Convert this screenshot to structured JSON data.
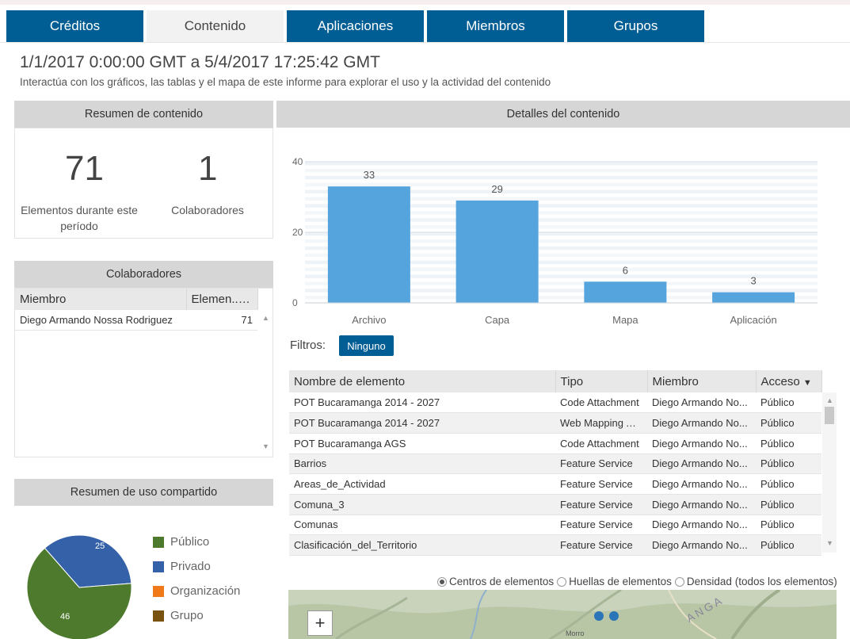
{
  "tabs": [
    {
      "label": "Créditos",
      "active": false
    },
    {
      "label": "Contenido",
      "active": true
    },
    {
      "label": "Aplicaciones",
      "active": false
    },
    {
      "label": "Miembros",
      "active": false
    },
    {
      "label": "Grupos",
      "active": false
    }
  ],
  "header": {
    "date_range": "1/1/2017 0:00:00 GMT a 5/4/2017 17:25:42 GMT",
    "subtitle": "Interactúa con los gráficos, las tablas y el mapa de este informe para explorar el uso y la actividad del contenido"
  },
  "summary": {
    "title": "Resumen de contenido",
    "items_count": "71",
    "items_label_1": "Elementos durante este",
    "items_label_2": "período",
    "contributors_count": "1",
    "contributors_label": "Colaboradores"
  },
  "contributors": {
    "title": "Colaboradores",
    "col_member": "Miembro",
    "col_items": "Elemen...",
    "rows": [
      {
        "member": "Diego Armando Nossa Rodriguez",
        "items": "71"
      }
    ]
  },
  "sharing": {
    "title": "Resumen de uso compartido",
    "legend": [
      {
        "label": "Público",
        "color": "#4e7a2e"
      },
      {
        "label": "Privado",
        "color": "#3461a8"
      },
      {
        "label": "Organización",
        "color": "#f07a1a"
      },
      {
        "label": "Grupo",
        "color": "#7a5210"
      }
    ],
    "pie_labels": {
      "privado": "25",
      "publico": "46"
    }
  },
  "details": {
    "title": "Detalles del contenido",
    "filters_label": "Filtros:",
    "filter_button": "Ninguno"
  },
  "chart_data": {
    "type": "bar",
    "categories": [
      "Archivo",
      "Capa",
      "Mapa",
      "Aplicación"
    ],
    "values": [
      33,
      29,
      6,
      3
    ],
    "data_labels": [
      "33",
      "29",
      "6",
      "3"
    ],
    "ylim": [
      0,
      40
    ],
    "yticks": [
      "0",
      "20",
      "40"
    ],
    "bar_color": "#55a4dd",
    "grid": true
  },
  "pie_data": {
    "type": "pie",
    "slices": [
      {
        "name": "Público",
        "value": 46,
        "color": "#4e7a2e"
      },
      {
        "name": "Privado",
        "value": 25,
        "color": "#3461a8"
      }
    ]
  },
  "items_table": {
    "columns": [
      "Nombre de elemento",
      "Tipo",
      "Miembro",
      "Acceso"
    ],
    "rows": [
      [
        "POT Bucaramanga 2014 - 2027",
        "Code Attachment",
        "Diego Armando No...",
        "Público"
      ],
      [
        "POT Bucaramanga 2014 - 2027",
        "Web Mapping Ap...",
        "Diego Armando No...",
        "Público"
      ],
      [
        "POT Bucaramanga AGS",
        "Code Attachment",
        "Diego Armando No...",
        "Público"
      ],
      [
        "Barrios",
        "Feature Service",
        "Diego Armando No...",
        "Público"
      ],
      [
        "Areas_de_Actividad",
        "Feature Service",
        "Diego Armando No...",
        "Público"
      ],
      [
        "Comuna_3",
        "Feature Service",
        "Diego Armando No...",
        "Público"
      ],
      [
        "Comunas",
        "Feature Service",
        "Diego Armando No...",
        "Público"
      ],
      [
        "Clasificación_del_Territorio",
        "Feature Service",
        "Diego Armando No...",
        "Público"
      ]
    ]
  },
  "map": {
    "options": [
      "Centros de elementos",
      "Huellas de elementos",
      "Densidad (todos los elementos)"
    ],
    "selected": "Centros de elementos",
    "zoom_in": "+",
    "place_label": "Morro",
    "river_label": "ANGA"
  }
}
